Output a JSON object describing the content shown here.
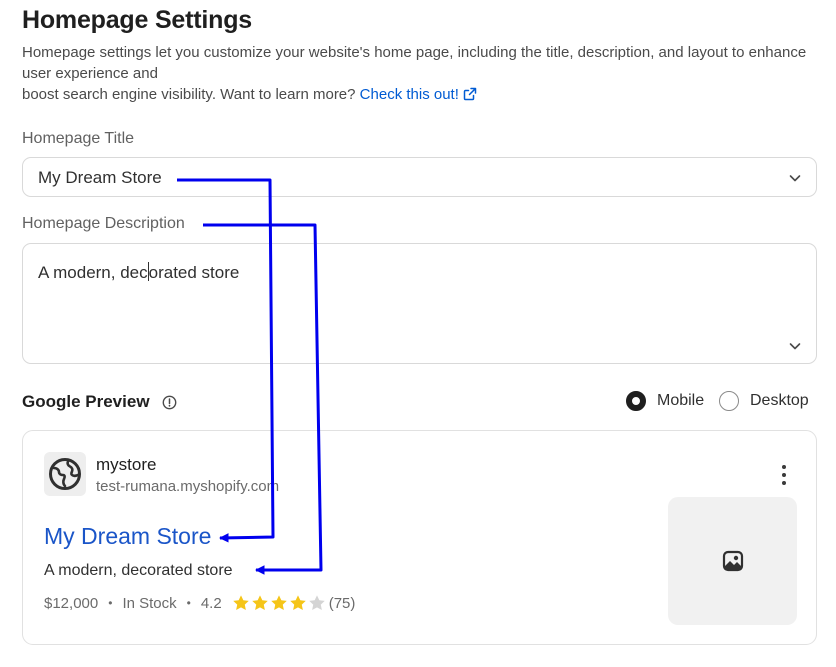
{
  "header": {
    "title": "Homepage Settings",
    "description_line1": "Homepage settings let you customize your website's home page, including the title, description, and layout to enhance user experience and",
    "description_line2": "boost search engine visibility. Want to learn more?",
    "learn_more_link": "Check this out!"
  },
  "fields": {
    "title_label": "Homepage Title",
    "title_value": "My Dream Store",
    "description_label": "Homepage Description",
    "description_value_before_caret": "A modern, dec",
    "description_value_after_caret": "orated store"
  },
  "preview": {
    "heading": "Google Preview",
    "device_options": [
      {
        "label": "Mobile",
        "selected": true
      },
      {
        "label": "Desktop",
        "selected": false
      }
    ],
    "site_name": "mystore",
    "site_url": "test-rumana.myshopify.com",
    "result_title": "My Dream Store",
    "result_description": "A modern, decorated store",
    "price": "$12,000",
    "stock": "In Stock",
    "rating": "4.2",
    "rating_stars": 4,
    "rating_max": 5,
    "review_count": "(75)"
  },
  "colors": {
    "link": "#005bd3",
    "result_title": "#1a55c8",
    "annotation_arrow": "#0000ee",
    "star_filled": "#f5c518",
    "star_empty": "#d4d4d4"
  },
  "icons": {
    "external_link": "external-link-icon",
    "chevron": "chevron-down-icon",
    "info": "info-icon",
    "globe": "globe-icon",
    "more": "kebab-menu-icon",
    "image_placeholder": "image-icon",
    "star": "star-icon"
  }
}
